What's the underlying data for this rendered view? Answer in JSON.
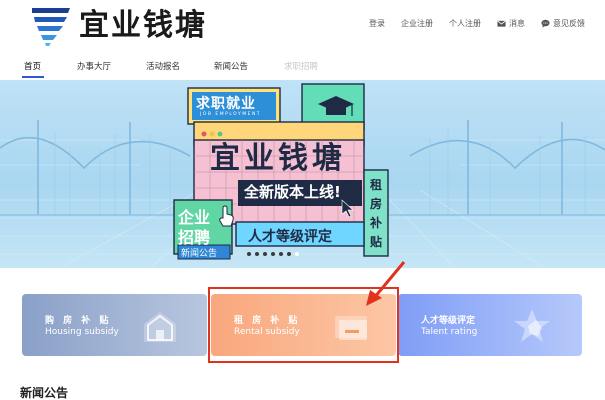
{
  "header": {
    "brand": "宜业钱塘",
    "links": {
      "login": "登录",
      "company_register": "企业注册",
      "personal_register": "个人注册",
      "messages": "消息",
      "feedback": "意见反馈"
    }
  },
  "nav": {
    "home": "首页",
    "service_hall": "办事大厅",
    "activity_signup": "活动报名",
    "news": "新闻公告",
    "job_hiring": "求职招聘"
  },
  "banner": {
    "job_seeking": "求职就业",
    "job_employment_en": "JOB EMPLOYMENT",
    "main_title": "宜业钱塘",
    "new_version": "全新版本上线!",
    "recruit_line1": "企业",
    "recruit_line2": "招聘",
    "news_tag": "新闻公告",
    "talent_grade": "人才等级评定",
    "rent_subsidy_vertical": [
      "租",
      "房",
      "补",
      "贴"
    ],
    "slide_count": 7,
    "active_slide": 6
  },
  "cards": {
    "housing": {
      "title": "购 房 补 贴",
      "subtitle": "Housing subsidy"
    },
    "rental": {
      "title": "租 房 补 贴",
      "subtitle": "Rental subsidy"
    },
    "talent": {
      "title": "人才等级评定",
      "subtitle": "Talent rating"
    }
  },
  "news_section": {
    "title": "新闻公告"
  },
  "colors": {
    "accent": "#2e59d6",
    "highlight": "#e0321f",
    "banner_sky": "#a9d6f1",
    "rental_card": "#f9a77d",
    "talent_card": "#7f9df6",
    "housing_card": "#8aa0c8"
  }
}
